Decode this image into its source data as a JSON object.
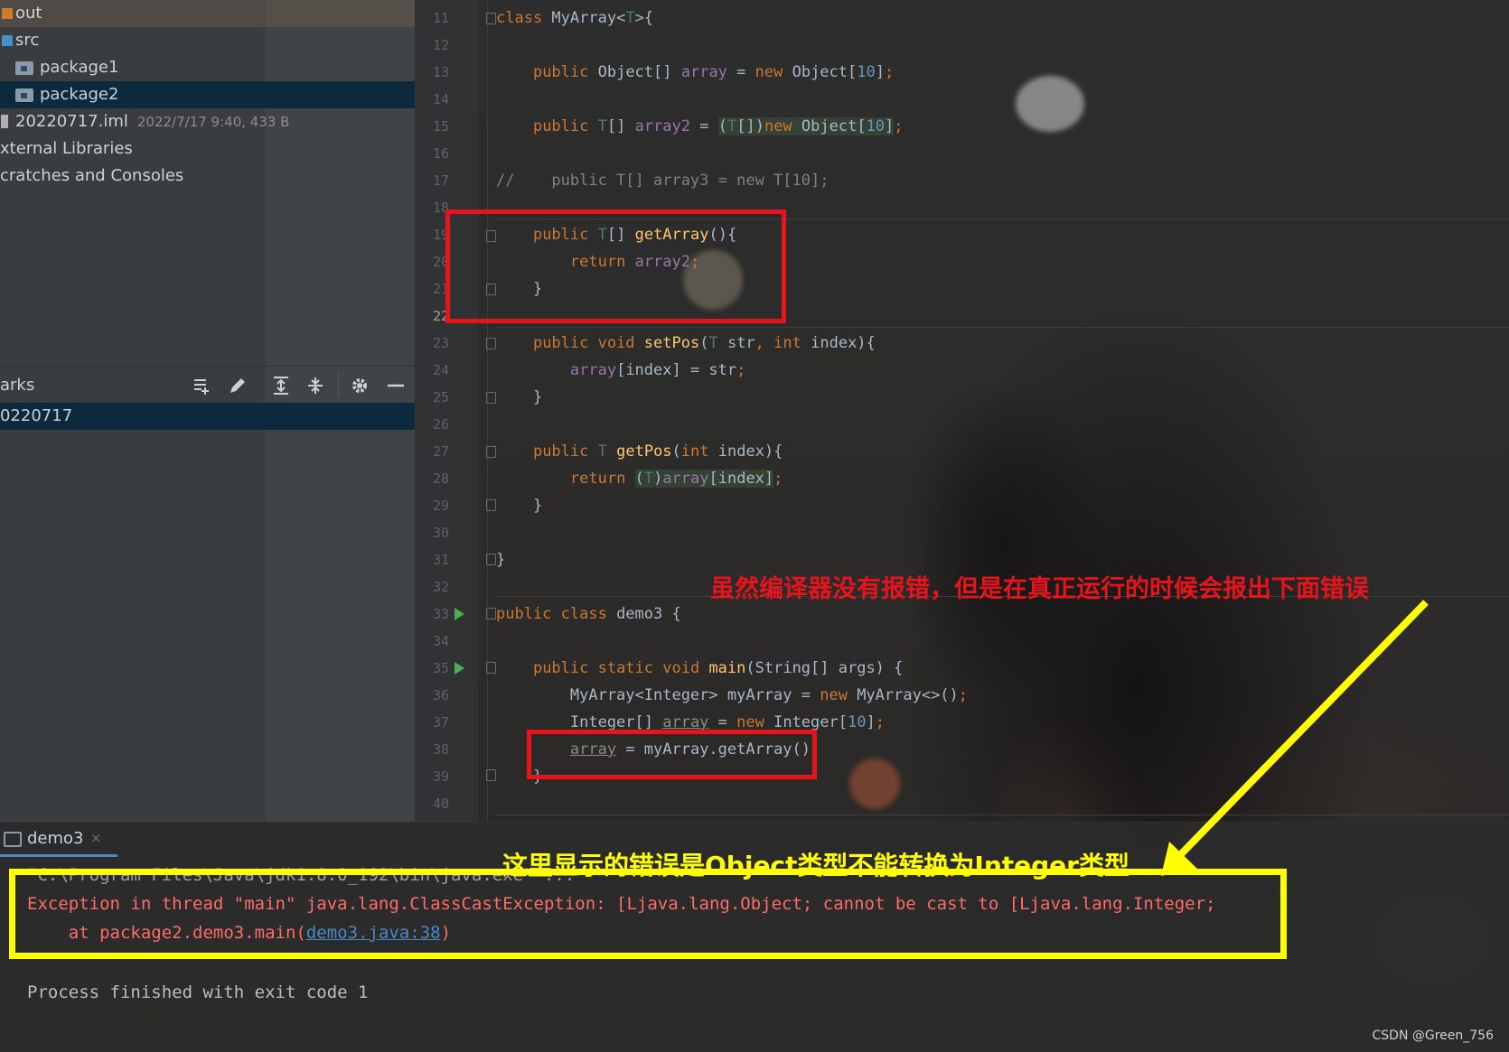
{
  "project_tree": {
    "rows": [
      {
        "label": "out",
        "icon": "folder-orange-icon"
      },
      {
        "label": "src",
        "icon": "folder-blue-icon"
      },
      {
        "label": "package1",
        "icon": "package-icon"
      },
      {
        "label": "package2",
        "icon": "package-icon"
      },
      {
        "label": "20220717.iml",
        "meta": "2022/7/17 9:40, 433 B",
        "icon": "iml-file-icon"
      },
      {
        "label": "xternal Libraries"
      },
      {
        "label": "cratches and Consoles"
      }
    ],
    "selected_index": 3
  },
  "bookmarks": {
    "title": "arks",
    "item": "0220717",
    "tools": [
      "add-bookmark-icon",
      "edit-icon",
      "expand-all-icon",
      "collapse-all-icon",
      "settings-gear-icon",
      "minimize-icon"
    ]
  },
  "editor": {
    "current_line": "22",
    "line_numbers": [
      "11",
      "12",
      "13",
      "14",
      "15",
      "16",
      "17",
      "18",
      "19",
      "20",
      "21",
      "22",
      "23",
      "24",
      "25",
      "26",
      "27",
      "28",
      "29",
      "30",
      "31",
      "32",
      "33",
      "34",
      "35",
      "36",
      "37",
      "38",
      "39",
      "40"
    ]
  },
  "annotations": {
    "top_note": "虽然编译器没有报错，但是在真正运行的时候会报出下面错误",
    "bottom_note": "这里显示的错误是Object类型不能转换为Integer类型",
    "colors": {
      "red": "#e8141c",
      "yellow": "#ffff00"
    }
  },
  "console": {
    "tab_label": "demo3",
    "tab_close": "×",
    "command_line": "\"C:\\Program Files\\Java\\jdk1.8.0_192\\bin\\java.exe\" ...",
    "exception_line": "Exception in thread \"main\" java.lang.ClassCastException: [Ljava.lang.Object; cannot be cast to [Ljava.lang.Integer;",
    "at_prefix": "    at package2.demo3.main(",
    "at_link": "demo3.java:38",
    "at_suffix": ")",
    "finish_line": "Process finished with exit code 1"
  },
  "watermark": "CSDN @Green_756"
}
